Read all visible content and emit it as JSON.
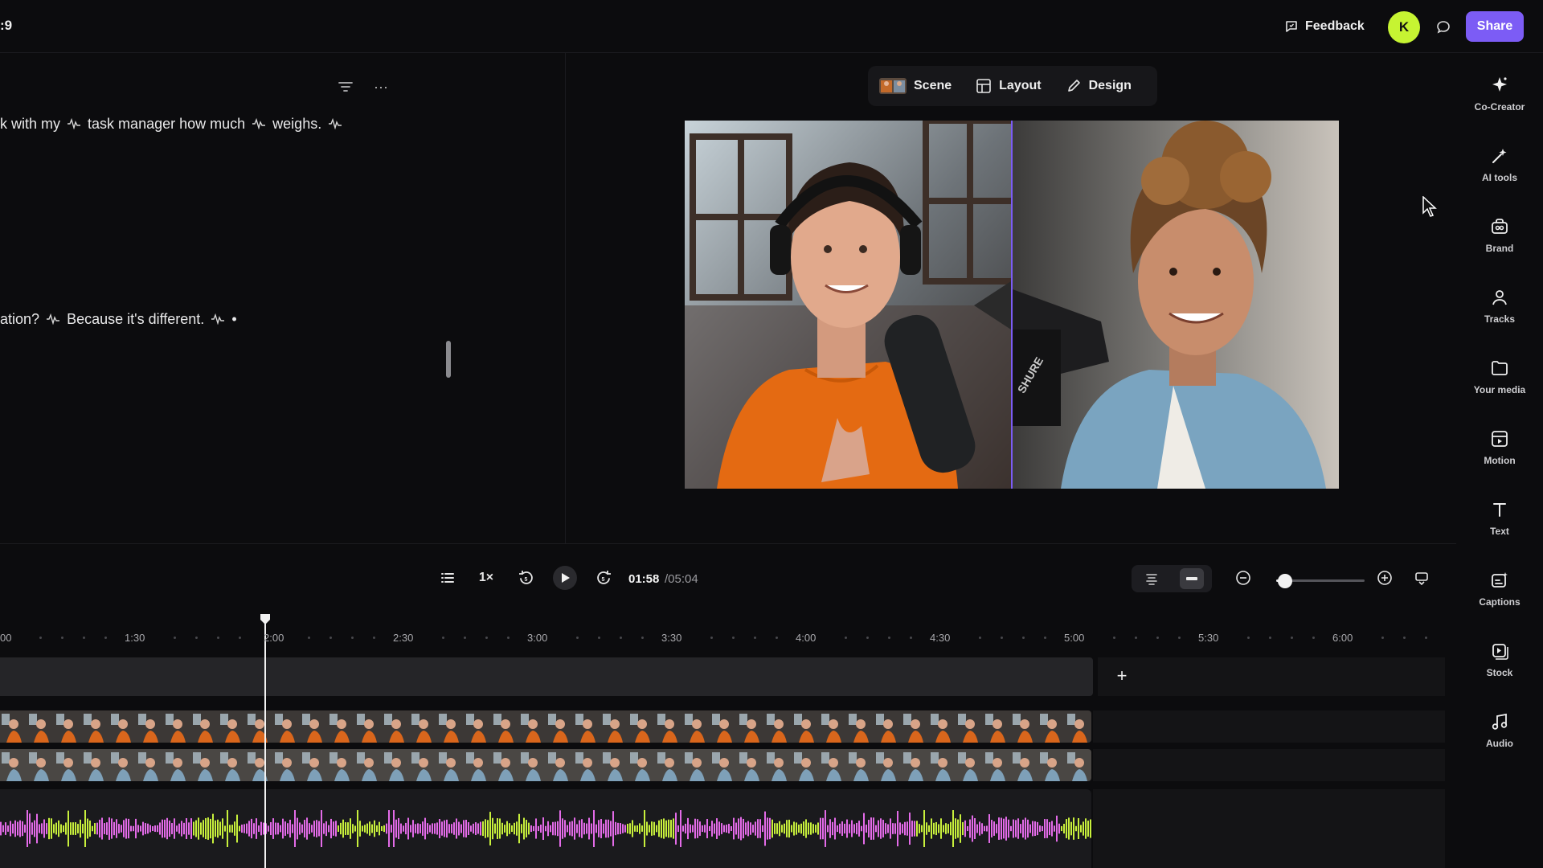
{
  "topbar": {
    "project_title": ":9",
    "feedback_label": "Feedback",
    "avatar_initial": "K",
    "share_label": "Share"
  },
  "transcript": {
    "line1": {
      "seg1": "k with my",
      "seg2": "task manager how much",
      "seg3": "weighs."
    },
    "line2": {
      "seg1": "ation?",
      "seg2": "Because it's different.",
      "seg3": "•"
    }
  },
  "preview_tabs": {
    "scene": "Scene",
    "layout": "Layout",
    "design": "Design"
  },
  "tools": [
    {
      "label": "Co-Creator",
      "icon": "sparkle-icon"
    },
    {
      "label": "AI tools",
      "icon": "magic-wand-icon"
    },
    {
      "label": "Brand",
      "icon": "brand-kit-icon"
    },
    {
      "label": "Tracks",
      "icon": "tracks-icon"
    },
    {
      "label": "Your media",
      "icon": "folder-icon"
    },
    {
      "label": "Motion",
      "icon": "motion-icon"
    },
    {
      "label": "Text",
      "icon": "text-icon"
    },
    {
      "label": "Captions",
      "icon": "captions-icon"
    },
    {
      "label": "Stock",
      "icon": "stock-icon"
    },
    {
      "label": "Audio",
      "icon": "music-note-icon"
    }
  ],
  "playback": {
    "speed": "1×",
    "time_current": "01:58",
    "time_total": "/05:04",
    "zoom_level": 0.1
  },
  "timeline": {
    "ticks": [
      "00",
      "1:30",
      "2:00",
      "2:30",
      "3:00",
      "3:30",
      "4:00",
      "4:30",
      "5:00",
      "5:30",
      "6:00"
    ],
    "playhead_time": "2:00"
  },
  "colors": {
    "accent": "#7c5cf5",
    "avatar": "#c6f432",
    "wave_pink": "#e36be8",
    "wave_green": "#c8f03c"
  }
}
